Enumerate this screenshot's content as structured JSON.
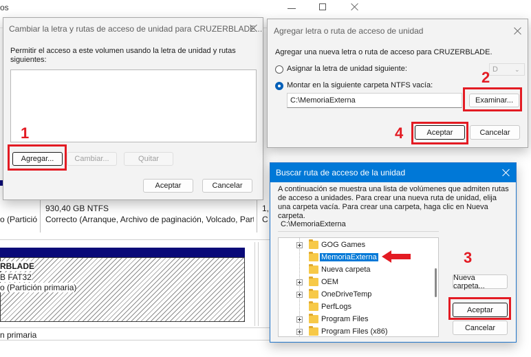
{
  "background_window": {
    "title_fragment": "os",
    "col_left_partial": "o (Partició",
    "disk_size": "930,40 GB NTFS",
    "disk_status": "Correcto (Arranque, Archivo de paginación, Volcado, Part",
    "col_right_a": "1,",
    "col_right_b": "C",
    "usb_name": "RBLADE",
    "usb_fs": "B FAT32",
    "usb_status": "o (Partición primaria)",
    "footer": "n primaria"
  },
  "dialog_change": {
    "title": "Cambiar la letra y rutas de acceso de unidad para CRUZERBLADE...",
    "description": "Permitir el acceso a este volumen usando la letra de unidad y rutas siguientes:",
    "add_label": "Agregar...",
    "change_label": "Cambiar...",
    "remove_label": "Quitar",
    "ok_label": "Aceptar",
    "cancel_label": "Cancelar"
  },
  "dialog_add": {
    "title": "Agregar letra o ruta de acceso de unidad",
    "description": "Agregar una nueva letra o ruta de acceso para CRUZERBLADE.",
    "option_letter_label": "Asignar la letra de unidad siguiente:",
    "letter_value": "D",
    "option_mount_label": "Montar en la siguiente carpeta NTFS vacía:",
    "path_value": "C:\\MemoriaExterna",
    "browse_label": "Examinar...",
    "ok_label": "Aceptar",
    "cancel_label": "Cancelar"
  },
  "dialog_browse": {
    "title": "Buscar ruta de acceso de la unidad",
    "description": "A continuación se muestra una lista de volúmenes que admiten rutas de acceso a unidades. Para crear una nueva ruta de unidad, elija una carpeta vacía. Para crear una carpeta, haga clic en Nueva carpeta.",
    "path_value": "C:\\MemoriaExterna",
    "tree_items": [
      {
        "label": "GOG Games",
        "expandable": true,
        "selected": false
      },
      {
        "label": "MemoriaExterna",
        "expandable": false,
        "selected": true
      },
      {
        "label": "Nueva carpeta",
        "expandable": false,
        "selected": false
      },
      {
        "label": "OEM",
        "expandable": true,
        "selected": false
      },
      {
        "label": "OneDriveTemp",
        "expandable": true,
        "selected": false
      },
      {
        "label": "PerfLogs",
        "expandable": false,
        "selected": false
      },
      {
        "label": "Program Files",
        "expandable": true,
        "selected": false
      },
      {
        "label": "Program Files (x86)",
        "expandable": true,
        "selected": false
      }
    ],
    "new_folder_label": "Nueva carpeta...",
    "ok_label": "Aceptar",
    "cancel_label": "Cancelar"
  },
  "annotations": {
    "step1": "1",
    "step2": "2",
    "step3": "3",
    "step4": "4",
    "color": "#e31b23"
  },
  "colors": {
    "accent": "#0078d7",
    "disk_bar": "#0a0a78"
  }
}
